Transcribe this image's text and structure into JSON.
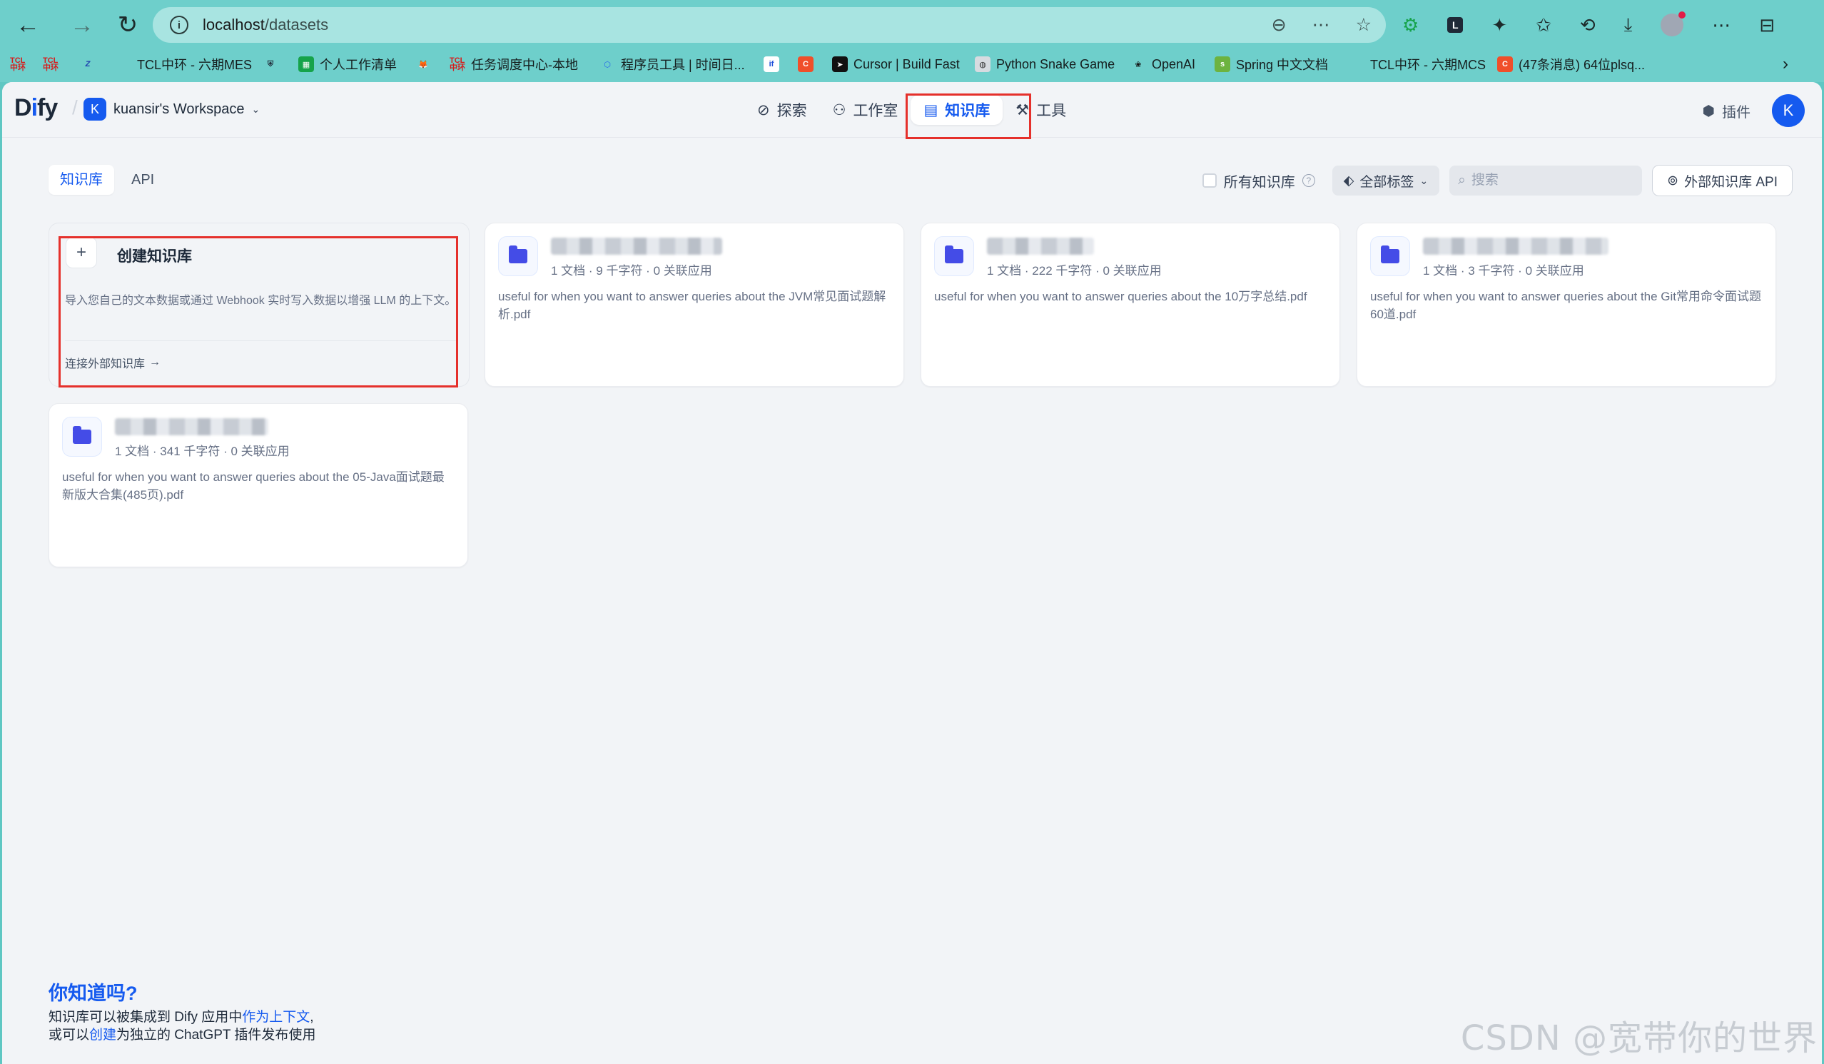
{
  "browser": {
    "url_host": "localhost",
    "url_path": "/datasets",
    "bookmarks": [
      {
        "label": "",
        "icon": "tcl-icon"
      },
      {
        "label": "",
        "icon": "tcl-icon"
      },
      {
        "label": "",
        "icon": "z-icon"
      },
      {
        "label": "TCL中环 - 六期MES",
        "icon": "none"
      },
      {
        "label": "",
        "icon": "shield-icon"
      },
      {
        "label": "个人工作清单",
        "icon": "sheet-icon"
      },
      {
        "label": "",
        "icon": "gitlab-icon"
      },
      {
        "label": "任务调度中心-本地",
        "icon": "tcl-icon"
      },
      {
        "label": "程序员工具 | 时间日...",
        "icon": "cube-icon"
      },
      {
        "label": "",
        "icon": "if-icon"
      },
      {
        "label": "",
        "icon": "c-icon"
      },
      {
        "label": "Cursor | Build Fast",
        "icon": "cursor-icon"
      },
      {
        "label": "Python Snake Game",
        "icon": "snake-icon"
      },
      {
        "label": "OpenAI",
        "icon": "openai-icon"
      },
      {
        "label": "Spring 中文文档",
        "icon": "spring-icon"
      },
      {
        "label": "TCL中环 - 六期MCS",
        "icon": "none"
      },
      {
        "label": "(47条消息) 64位plsq...",
        "icon": "c-icon"
      }
    ]
  },
  "header": {
    "logo": "Dify",
    "workspace_badge": "K",
    "workspace_name": "kuansir's Workspace",
    "nav": [
      {
        "label": "探索",
        "icon": "compass-icon",
        "active": false
      },
      {
        "label": "工作室",
        "icon": "robot-icon",
        "active": false
      },
      {
        "label": "知识库",
        "icon": "book-icon",
        "active": true
      },
      {
        "label": "工具",
        "icon": "hammer-icon",
        "active": false
      }
    ],
    "plugin_label": "插件",
    "avatar": "K"
  },
  "tabs": [
    {
      "label": "知识库",
      "active": true
    },
    {
      "label": "API",
      "active": false
    }
  ],
  "filters": {
    "all_knowledge_label": "所有知识库",
    "tags_label": "全部标签",
    "search_placeholder": "搜索",
    "external_api_label": "外部知识库 API"
  },
  "create_card": {
    "title": "创建知识库",
    "description": "导入您自己的文本数据或通过 Webhook 实时写入数据以增强 LLM 的上下文。",
    "link": "连接外部知识库"
  },
  "datasets": [
    {
      "meta": "1 文档 · 9 千字符 · 0 关联应用",
      "description": "useful for when you want to answer queries about the JVM常见面试题解析.pdf"
    },
    {
      "meta": "1 文档 · 222 千字符 · 0 关联应用",
      "description": "useful for when you want to answer queries about the 10万字总结.pdf"
    },
    {
      "meta": "1 文档 · 3 千字符 · 0 关联应用",
      "description": "useful for when you want to answer queries about the Git常用命令面试题 60道.pdf"
    },
    {
      "meta": "1 文档 · 341 千字符 · 0 关联应用",
      "description": "useful for when you want to answer queries about the 05-Java面试题最新版大合集(485页).pdf"
    }
  ],
  "tip": {
    "title": "你知道吗?",
    "line1_a": "知识库可以被集成到 Dify 应用中",
    "line1_link": "作为上下文",
    "line1_b": ",",
    "line2_a": "或可以",
    "line2_link": "创建",
    "line2_b": "为独立的 ChatGPT 插件发布使用"
  },
  "watermark": "CSDN @宽带你的世界",
  "colors": {
    "accent": "#155aef",
    "highlight_box": "#e5302b",
    "folder": "#444ce7"
  }
}
